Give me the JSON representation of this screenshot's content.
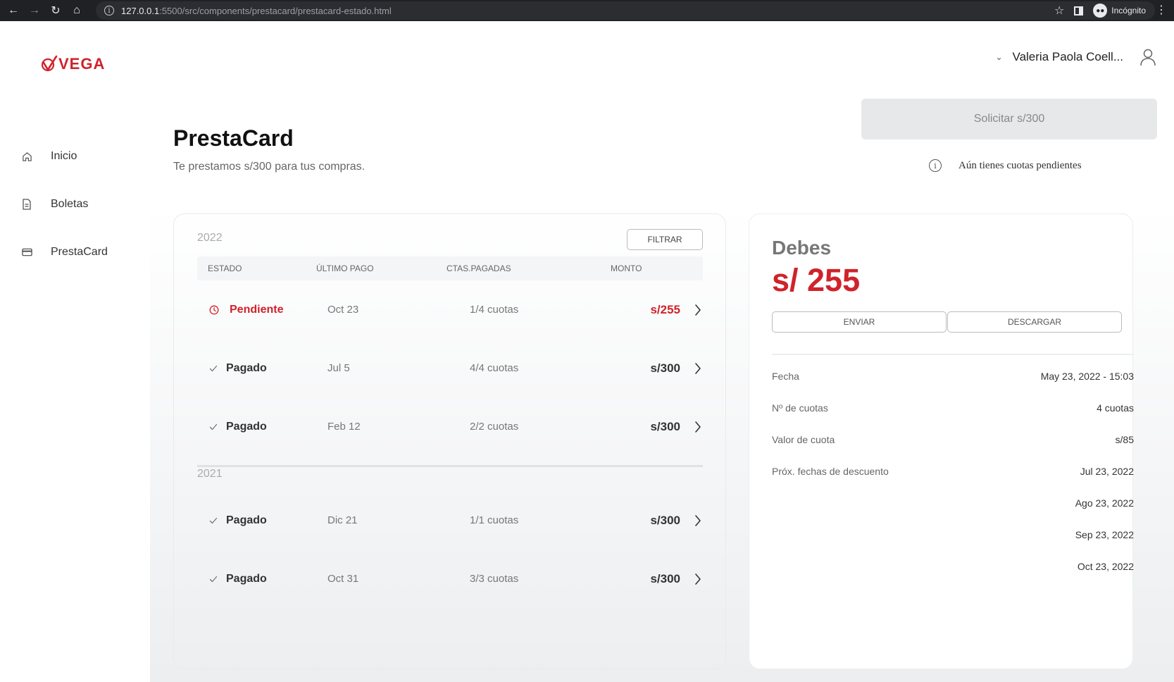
{
  "browser": {
    "url_host": "127.0.0.1",
    "url_path": ":5500/src/components/prestacard/prestacard-estado.html",
    "profile": "Incógnito"
  },
  "brand": {
    "name": "VEGA",
    "color": "#d0222b"
  },
  "sidebar": {
    "items": [
      {
        "label": "Inicio",
        "icon": "home-icon"
      },
      {
        "label": "Boletas",
        "icon": "document-icon"
      },
      {
        "label": "PrestaCard",
        "icon": "card-icon"
      }
    ]
  },
  "header": {
    "user_name": "Valeria Paola Coell..."
  },
  "page": {
    "title": "PrestaCard",
    "subtitle": "Te prestamos s/300 para tus compras.",
    "request_button": "Solicitar s/300",
    "notice": "Aún tienes cuotas pendientes"
  },
  "history": {
    "filter_button": "FILTRAR",
    "columns": [
      "ESTADO",
      "ÚLTIMO PAGO",
      "CTAS.PAGADAS",
      "MONTO"
    ],
    "groups": [
      {
        "year": "2022",
        "rows": [
          {
            "status": "Pendiente",
            "last_payment": "Oct 23",
            "installments": "1/4 cuotas",
            "amount": "s/255"
          },
          {
            "status": "Pagado",
            "last_payment": "Jul 5",
            "installments": "4/4 cuotas",
            "amount": "s/300"
          },
          {
            "status": "Pagado",
            "last_payment": "Feb 12",
            "installments": "2/2 cuotas",
            "amount": "s/300"
          }
        ]
      },
      {
        "year": "2021",
        "rows": [
          {
            "status": "Pagado",
            "last_payment": "Dic 21",
            "installments": "1/1 cuotas",
            "amount": "s/300"
          },
          {
            "status": "Pagado",
            "last_payment": "Oct 31",
            "installments": "3/3 cuotas",
            "amount": "s/300"
          }
        ]
      }
    ]
  },
  "summary": {
    "heading": "Debes",
    "amount": "s/ 255",
    "send_button": "ENVIAR",
    "download_button": "DESCARGAR",
    "details": [
      {
        "label": "Fecha",
        "value": "May 23, 2022 - 15:03"
      },
      {
        "label": "Nº de cuotas",
        "value": "4 cuotas"
      },
      {
        "label": "Valor de cuota",
        "value": "s/85"
      },
      {
        "label": "Próx. fechas de descuento",
        "value": "Jul 23, 2022"
      },
      {
        "label": "",
        "value": "Ago 23, 2022"
      },
      {
        "label": "",
        "value": "Sep 23, 2022"
      },
      {
        "label": "",
        "value": "Oct 23, 2022"
      }
    ]
  }
}
